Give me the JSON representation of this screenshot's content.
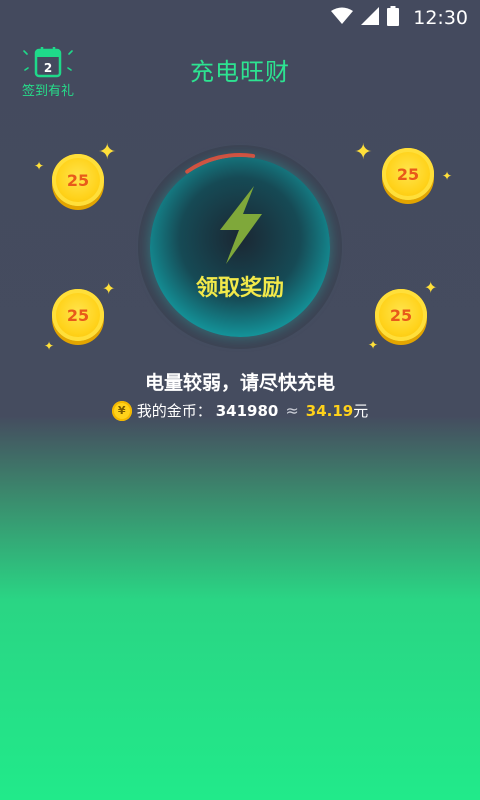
{
  "status_bar": {
    "time": "12:30",
    "icons": [
      "wifi-icon",
      "signal-icon",
      "battery-icon"
    ]
  },
  "signin": {
    "day": "2",
    "label": "签到有礼",
    "icon": "calendar-icon"
  },
  "header": {
    "title": "充电旺财"
  },
  "coins": [
    {
      "value": "25"
    },
    {
      "value": "25"
    },
    {
      "value": "25"
    },
    {
      "value": "25"
    }
  ],
  "charger": {
    "claim_label": "领取奖励",
    "icon": "lightning-bolt-icon",
    "progress": 0.12
  },
  "status": {
    "message": "电量较弱，请尽快充电"
  },
  "balance": {
    "icon": "yen-coin-icon",
    "yen_symbol": "¥",
    "label": "我的金币：",
    "coins": "341980",
    "approx": "≈",
    "money": "34.19",
    "unit": "元"
  },
  "colors": {
    "accent_green": "#2de391",
    "coin_gold": "#ffd21a",
    "claim_yellow": "#f2e94a",
    "progress_red": "#e8402e"
  }
}
